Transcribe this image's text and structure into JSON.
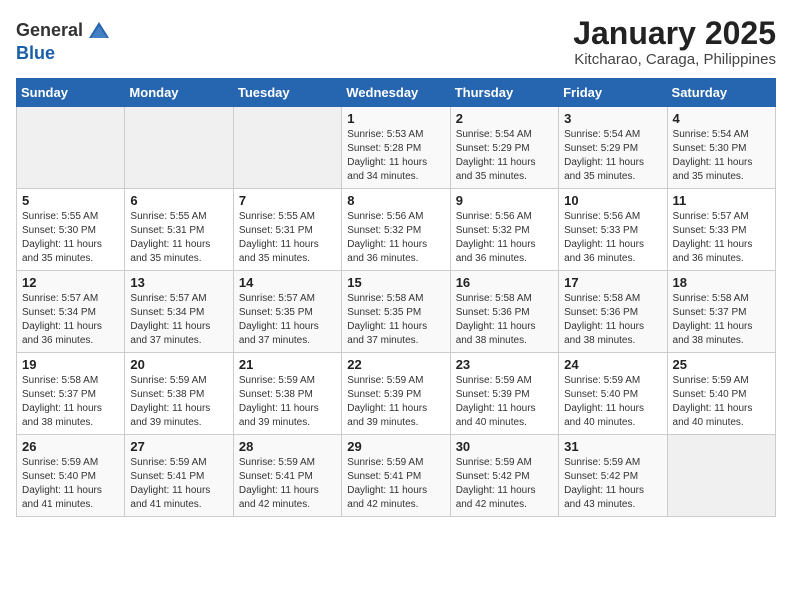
{
  "logo": {
    "general": "General",
    "blue": "Blue"
  },
  "title": "January 2025",
  "subtitle": "Kitcharao, Caraga, Philippines",
  "days_header": [
    "Sunday",
    "Monday",
    "Tuesday",
    "Wednesday",
    "Thursday",
    "Friday",
    "Saturday"
  ],
  "weeks": [
    [
      {
        "day": "",
        "info": ""
      },
      {
        "day": "",
        "info": ""
      },
      {
        "day": "",
        "info": ""
      },
      {
        "day": "1",
        "info": "Sunrise: 5:53 AM\nSunset: 5:28 PM\nDaylight: 11 hours\nand 34 minutes."
      },
      {
        "day": "2",
        "info": "Sunrise: 5:54 AM\nSunset: 5:29 PM\nDaylight: 11 hours\nand 35 minutes."
      },
      {
        "day": "3",
        "info": "Sunrise: 5:54 AM\nSunset: 5:29 PM\nDaylight: 11 hours\nand 35 minutes."
      },
      {
        "day": "4",
        "info": "Sunrise: 5:54 AM\nSunset: 5:30 PM\nDaylight: 11 hours\nand 35 minutes."
      }
    ],
    [
      {
        "day": "5",
        "info": "Sunrise: 5:55 AM\nSunset: 5:30 PM\nDaylight: 11 hours\nand 35 minutes."
      },
      {
        "day": "6",
        "info": "Sunrise: 5:55 AM\nSunset: 5:31 PM\nDaylight: 11 hours\nand 35 minutes."
      },
      {
        "day": "7",
        "info": "Sunrise: 5:55 AM\nSunset: 5:31 PM\nDaylight: 11 hours\nand 35 minutes."
      },
      {
        "day": "8",
        "info": "Sunrise: 5:56 AM\nSunset: 5:32 PM\nDaylight: 11 hours\nand 36 minutes."
      },
      {
        "day": "9",
        "info": "Sunrise: 5:56 AM\nSunset: 5:32 PM\nDaylight: 11 hours\nand 36 minutes."
      },
      {
        "day": "10",
        "info": "Sunrise: 5:56 AM\nSunset: 5:33 PM\nDaylight: 11 hours\nand 36 minutes."
      },
      {
        "day": "11",
        "info": "Sunrise: 5:57 AM\nSunset: 5:33 PM\nDaylight: 11 hours\nand 36 minutes."
      }
    ],
    [
      {
        "day": "12",
        "info": "Sunrise: 5:57 AM\nSunset: 5:34 PM\nDaylight: 11 hours\nand 36 minutes."
      },
      {
        "day": "13",
        "info": "Sunrise: 5:57 AM\nSunset: 5:34 PM\nDaylight: 11 hours\nand 37 minutes."
      },
      {
        "day": "14",
        "info": "Sunrise: 5:57 AM\nSunset: 5:35 PM\nDaylight: 11 hours\nand 37 minutes."
      },
      {
        "day": "15",
        "info": "Sunrise: 5:58 AM\nSunset: 5:35 PM\nDaylight: 11 hours\nand 37 minutes."
      },
      {
        "day": "16",
        "info": "Sunrise: 5:58 AM\nSunset: 5:36 PM\nDaylight: 11 hours\nand 38 minutes."
      },
      {
        "day": "17",
        "info": "Sunrise: 5:58 AM\nSunset: 5:36 PM\nDaylight: 11 hours\nand 38 minutes."
      },
      {
        "day": "18",
        "info": "Sunrise: 5:58 AM\nSunset: 5:37 PM\nDaylight: 11 hours\nand 38 minutes."
      }
    ],
    [
      {
        "day": "19",
        "info": "Sunrise: 5:58 AM\nSunset: 5:37 PM\nDaylight: 11 hours\nand 38 minutes."
      },
      {
        "day": "20",
        "info": "Sunrise: 5:59 AM\nSunset: 5:38 PM\nDaylight: 11 hours\nand 39 minutes."
      },
      {
        "day": "21",
        "info": "Sunrise: 5:59 AM\nSunset: 5:38 PM\nDaylight: 11 hours\nand 39 minutes."
      },
      {
        "day": "22",
        "info": "Sunrise: 5:59 AM\nSunset: 5:39 PM\nDaylight: 11 hours\nand 39 minutes."
      },
      {
        "day": "23",
        "info": "Sunrise: 5:59 AM\nSunset: 5:39 PM\nDaylight: 11 hours\nand 40 minutes."
      },
      {
        "day": "24",
        "info": "Sunrise: 5:59 AM\nSunset: 5:40 PM\nDaylight: 11 hours\nand 40 minutes."
      },
      {
        "day": "25",
        "info": "Sunrise: 5:59 AM\nSunset: 5:40 PM\nDaylight: 11 hours\nand 40 minutes."
      }
    ],
    [
      {
        "day": "26",
        "info": "Sunrise: 5:59 AM\nSunset: 5:40 PM\nDaylight: 11 hours\nand 41 minutes."
      },
      {
        "day": "27",
        "info": "Sunrise: 5:59 AM\nSunset: 5:41 PM\nDaylight: 11 hours\nand 41 minutes."
      },
      {
        "day": "28",
        "info": "Sunrise: 5:59 AM\nSunset: 5:41 PM\nDaylight: 11 hours\nand 42 minutes."
      },
      {
        "day": "29",
        "info": "Sunrise: 5:59 AM\nSunset: 5:41 PM\nDaylight: 11 hours\nand 42 minutes."
      },
      {
        "day": "30",
        "info": "Sunrise: 5:59 AM\nSunset: 5:42 PM\nDaylight: 11 hours\nand 42 minutes."
      },
      {
        "day": "31",
        "info": "Sunrise: 5:59 AM\nSunset: 5:42 PM\nDaylight: 11 hours\nand 43 minutes."
      },
      {
        "day": "",
        "info": ""
      }
    ]
  ]
}
